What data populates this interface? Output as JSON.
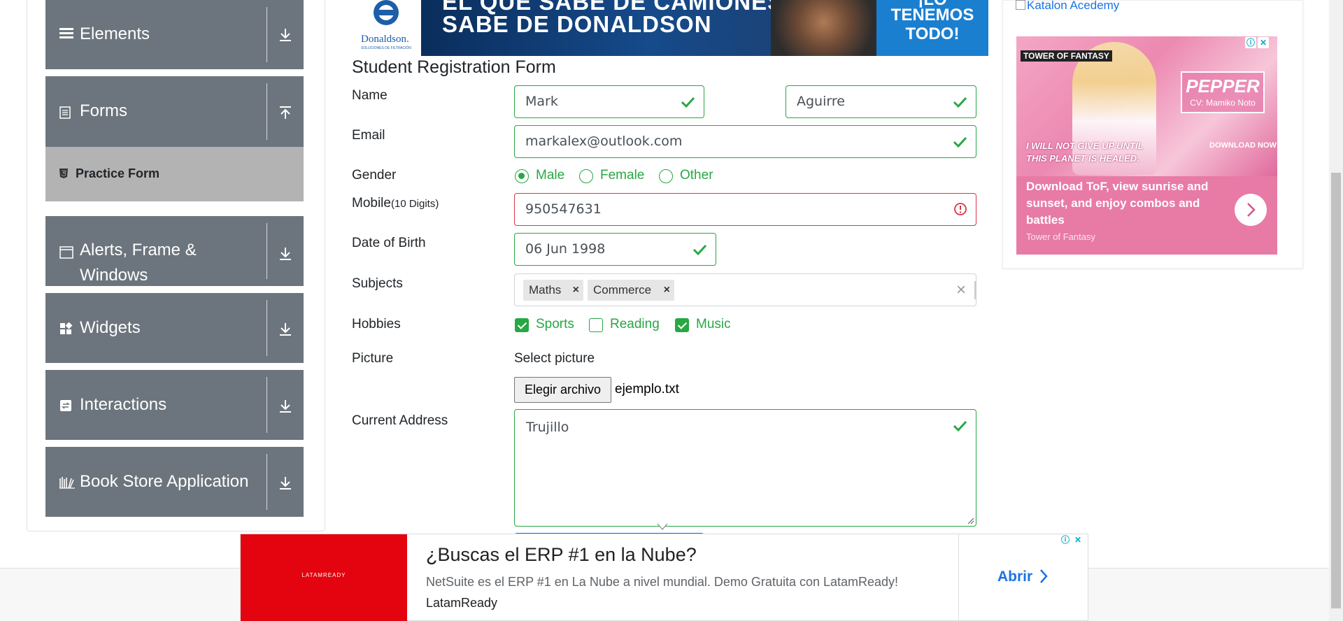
{
  "sidebar": {
    "groups": [
      {
        "key": "elements",
        "label": "Elements"
      },
      {
        "key": "forms",
        "label": "Forms"
      },
      {
        "key": "alerts",
        "label": "Alerts, Frame & Windows"
      },
      {
        "key": "widgets",
        "label": "Widgets"
      },
      {
        "key": "interactions",
        "label": "Interactions"
      },
      {
        "key": "bookstore",
        "label": "Book Store Application"
      }
    ],
    "active_item": "Practice Form"
  },
  "top_banner": {
    "brand": "Donaldson.",
    "brand_sub": "SOLUCIONES DE FILTRACIÓN",
    "headline_1": "EL QUE SABE DE CAMIONES",
    "headline_2": "SABE DE DONALDSON",
    "cta_1": "¡LO",
    "cta_2": "TENEMOS",
    "cta_3": "TODO!"
  },
  "form": {
    "title": "Student Registration Form",
    "labels": {
      "name": "Name",
      "email": "Email",
      "gender": "Gender",
      "mobile": "Mobile",
      "mobile_hint": "(10 Digits)",
      "dob": "Date of Birth",
      "subjects": "Subjects",
      "hobbies": "Hobbies",
      "picture": "Picture",
      "address": "Current Address"
    },
    "first_name": "Mark",
    "last_name": "Aguirre",
    "email": "markalex@outlook.com",
    "gender_options": [
      "Male",
      "Female",
      "Other"
    ],
    "gender_selected": "Male",
    "mobile": "950547631",
    "mobile_valid": false,
    "dob": "06 Jun 1998",
    "subjects": [
      "Maths",
      "Commerce"
    ],
    "hobbies": [
      {
        "label": "Sports",
        "checked": true
      },
      {
        "label": "Reading",
        "checked": false
      },
      {
        "label": "Music",
        "checked": true
      }
    ],
    "picture_label": "Select picture",
    "file_button": "Elegir archivo",
    "file_name": "ejemplo.txt",
    "address": "Trujillo"
  },
  "right_ad": {
    "broken_link": "Katalon Acedemy",
    "game_brand": "TOWER OF FANTASY",
    "character": "PEPPER",
    "character_sub": "CV: Mamiko Noto",
    "tagline_1": "I WILL NOT GIVE UP UNTIL",
    "tagline_2": "THIS PLANET IS HEALED.",
    "download_note": "DOWNLOAD NOW",
    "description": "Download ToF, view sunrise and sunset, and enjoy combos and battles",
    "advertiser": "Tower of Fantasy"
  },
  "bottom_ad": {
    "logo": "LATAMREADY",
    "title": "¿Buscas el ERP #1 en la Nube?",
    "description": "NetSuite es el ERP #1 en La Nube a nivel mundial. Demo Gratuita con LatamReady!",
    "advertiser": "LatamReady",
    "cta": "Abrir"
  },
  "colors": {
    "sidebar_bg": "#6c757d",
    "active_item_bg": "#b3b3b3",
    "valid": "#28a745",
    "invalid": "#dc3545",
    "link": "#1a73e8"
  }
}
